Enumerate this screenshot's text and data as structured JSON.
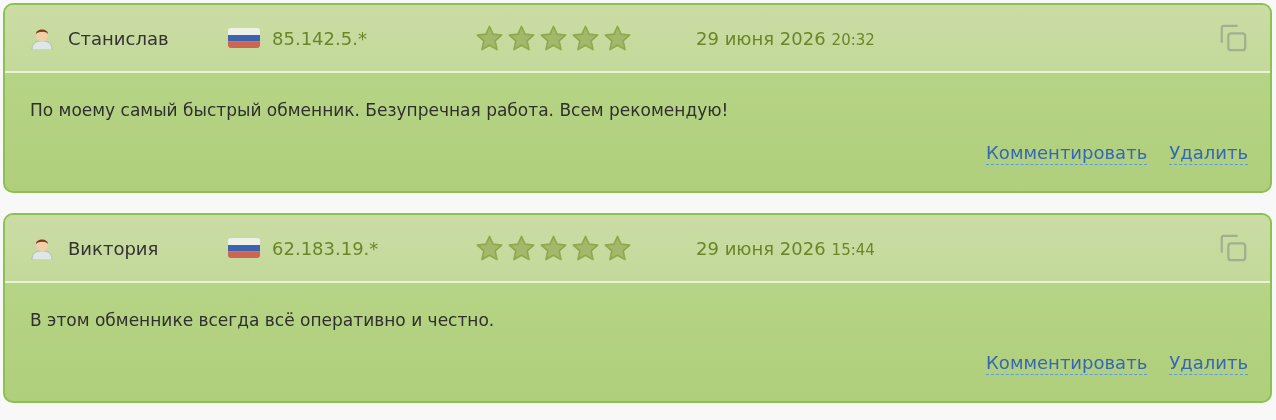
{
  "reviews": [
    {
      "author": "Станислав",
      "ip": "85.142.5.*",
      "stars": 5,
      "date": "29 июня 2026",
      "time": "20:32",
      "text": "По моему самый быстрый обменник. Безупречная работа. Всем рекомендую!",
      "actions": [
        "Комментировать",
        "Удалить"
      ]
    },
    {
      "author": "Виктория",
      "ip": "62.183.19.*",
      "stars": 5,
      "date": "29 июня 2026",
      "time": "15:44",
      "text": "В этом обменнике всегда всё оперативно и честно.",
      "actions": [
        "Комментировать",
        "Удалить"
      ]
    }
  ]
}
